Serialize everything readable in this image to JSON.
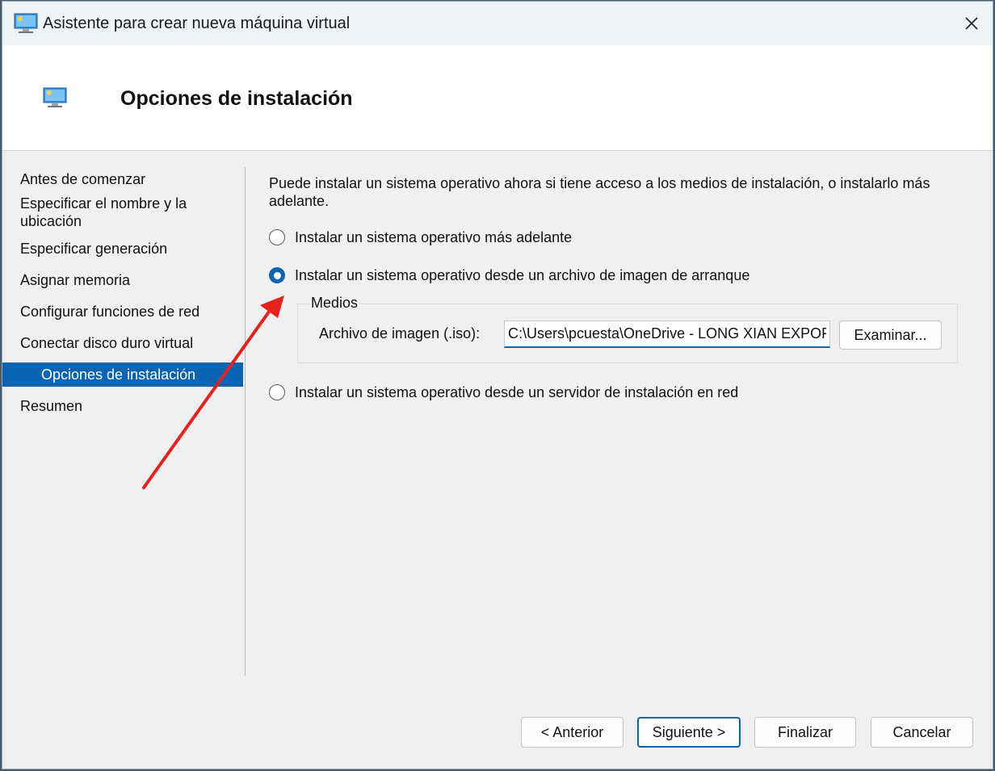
{
  "window": {
    "title": "Asistente para crear nueva máquina virtual",
    "close_label": "×"
  },
  "header": {
    "title": "Opciones de instalación"
  },
  "sidebar": {
    "items": [
      {
        "label": "Antes de comenzar"
      },
      {
        "label": "Especificar el nombre y la ubicación"
      },
      {
        "label": "Especificar generación"
      },
      {
        "label": "Asignar memoria"
      },
      {
        "label": "Configurar funciones de red"
      },
      {
        "label": "Conectar disco duro virtual"
      },
      {
        "label": "Opciones de instalación"
      },
      {
        "label": "Resumen"
      }
    ],
    "selected_index": 6
  },
  "content": {
    "intro": "Puede instalar un sistema operativo ahora si tiene acceso a los medios de instalación, o instalarlo más adelante.",
    "options": [
      {
        "label": "Instalar un sistema operativo más adelante",
        "checked": false
      },
      {
        "label": "Instalar un sistema operativo desde un archivo de imagen de arranque",
        "checked": true
      },
      {
        "label": "Instalar un sistema operativo desde un servidor de instalación en red",
        "checked": false
      }
    ],
    "media": {
      "group_label": "Medios",
      "field_label": "Archivo de imagen (.iso):",
      "field_value": "C:\\Users\\pcuesta\\OneDrive - LONG XIAN EXPOF",
      "browse_label": "Examinar..."
    }
  },
  "footer": {
    "back_label": "< Anterior",
    "next_label": "Siguiente >",
    "finish_label": "Finalizar",
    "cancel_label": "Cancelar"
  },
  "colors": {
    "accent": "#0a64b4",
    "annotation_arrow": "#e8201c"
  },
  "icons": {
    "title": "virtual-machine-icon",
    "header": "virtual-machine-icon",
    "close": "close-icon"
  }
}
